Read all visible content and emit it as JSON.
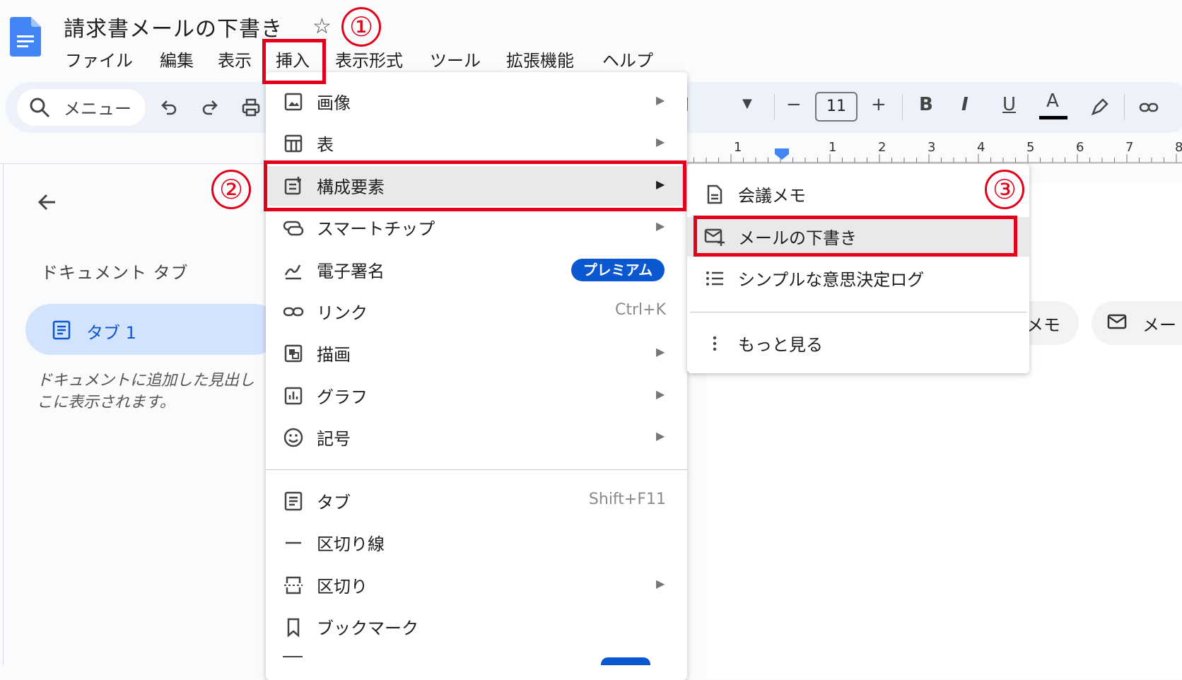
{
  "header": {
    "title": "請求書メールの下書き",
    "menubar": [
      "ファイル",
      "編集",
      "表示",
      "挿入",
      "表示形式",
      "ツール",
      "拡張機能",
      "ヘルプ"
    ]
  },
  "toolbar": {
    "search_label": "メニュー",
    "font_size": "11",
    "minus": "−",
    "plus": "+",
    "bold": "B",
    "italic": "I",
    "underline": "U",
    "text_color": "A"
  },
  "ruler": {
    "labels": [
      "1",
      "1",
      "2",
      "3",
      "4",
      "5",
      "6",
      "7",
      "8"
    ]
  },
  "sidebar": {
    "heading": "ドキュメント タブ",
    "tab1": "タブ 1",
    "hint_line1": "ドキュメントに追加した見出し",
    "hint_line2": "こに表示されます。"
  },
  "chips": {
    "chip1": "メモ",
    "chip2": "メー"
  },
  "insert_menu": {
    "items": [
      {
        "label": "画像",
        "shortcut": ""
      },
      {
        "label": "表",
        "shortcut": ""
      },
      {
        "label": "構成要素",
        "shortcut": ""
      },
      {
        "label": "スマートチップ",
        "shortcut": ""
      },
      {
        "label": "電子署名",
        "shortcut": ""
      },
      {
        "label": "リンク",
        "shortcut": "Ctrl+K"
      },
      {
        "label": "描画",
        "shortcut": ""
      },
      {
        "label": "グラフ",
        "shortcut": ""
      },
      {
        "label": "記号",
        "shortcut": ""
      },
      {
        "label": "タブ",
        "shortcut": "Shift+F11"
      },
      {
        "label": "区切り線",
        "shortcut": ""
      },
      {
        "label": "区切り",
        "shortcut": ""
      },
      {
        "label": "ブックマーク",
        "shortcut": ""
      }
    ],
    "premium_badge": "プレミアム"
  },
  "components_submenu": {
    "items": [
      "会議メモ",
      "メールの下書き",
      "シンプルな意思決定ログ",
      "もっと見る"
    ]
  },
  "annotations": {
    "step1": "①",
    "step2": "②",
    "step3": "③"
  },
  "colors": {
    "annotation_red": "#e3001b",
    "brand_blue": "#0b57d0",
    "docs_icon_blue": "#4285f4",
    "selected_tab_bg": "#d3e3fd"
  }
}
